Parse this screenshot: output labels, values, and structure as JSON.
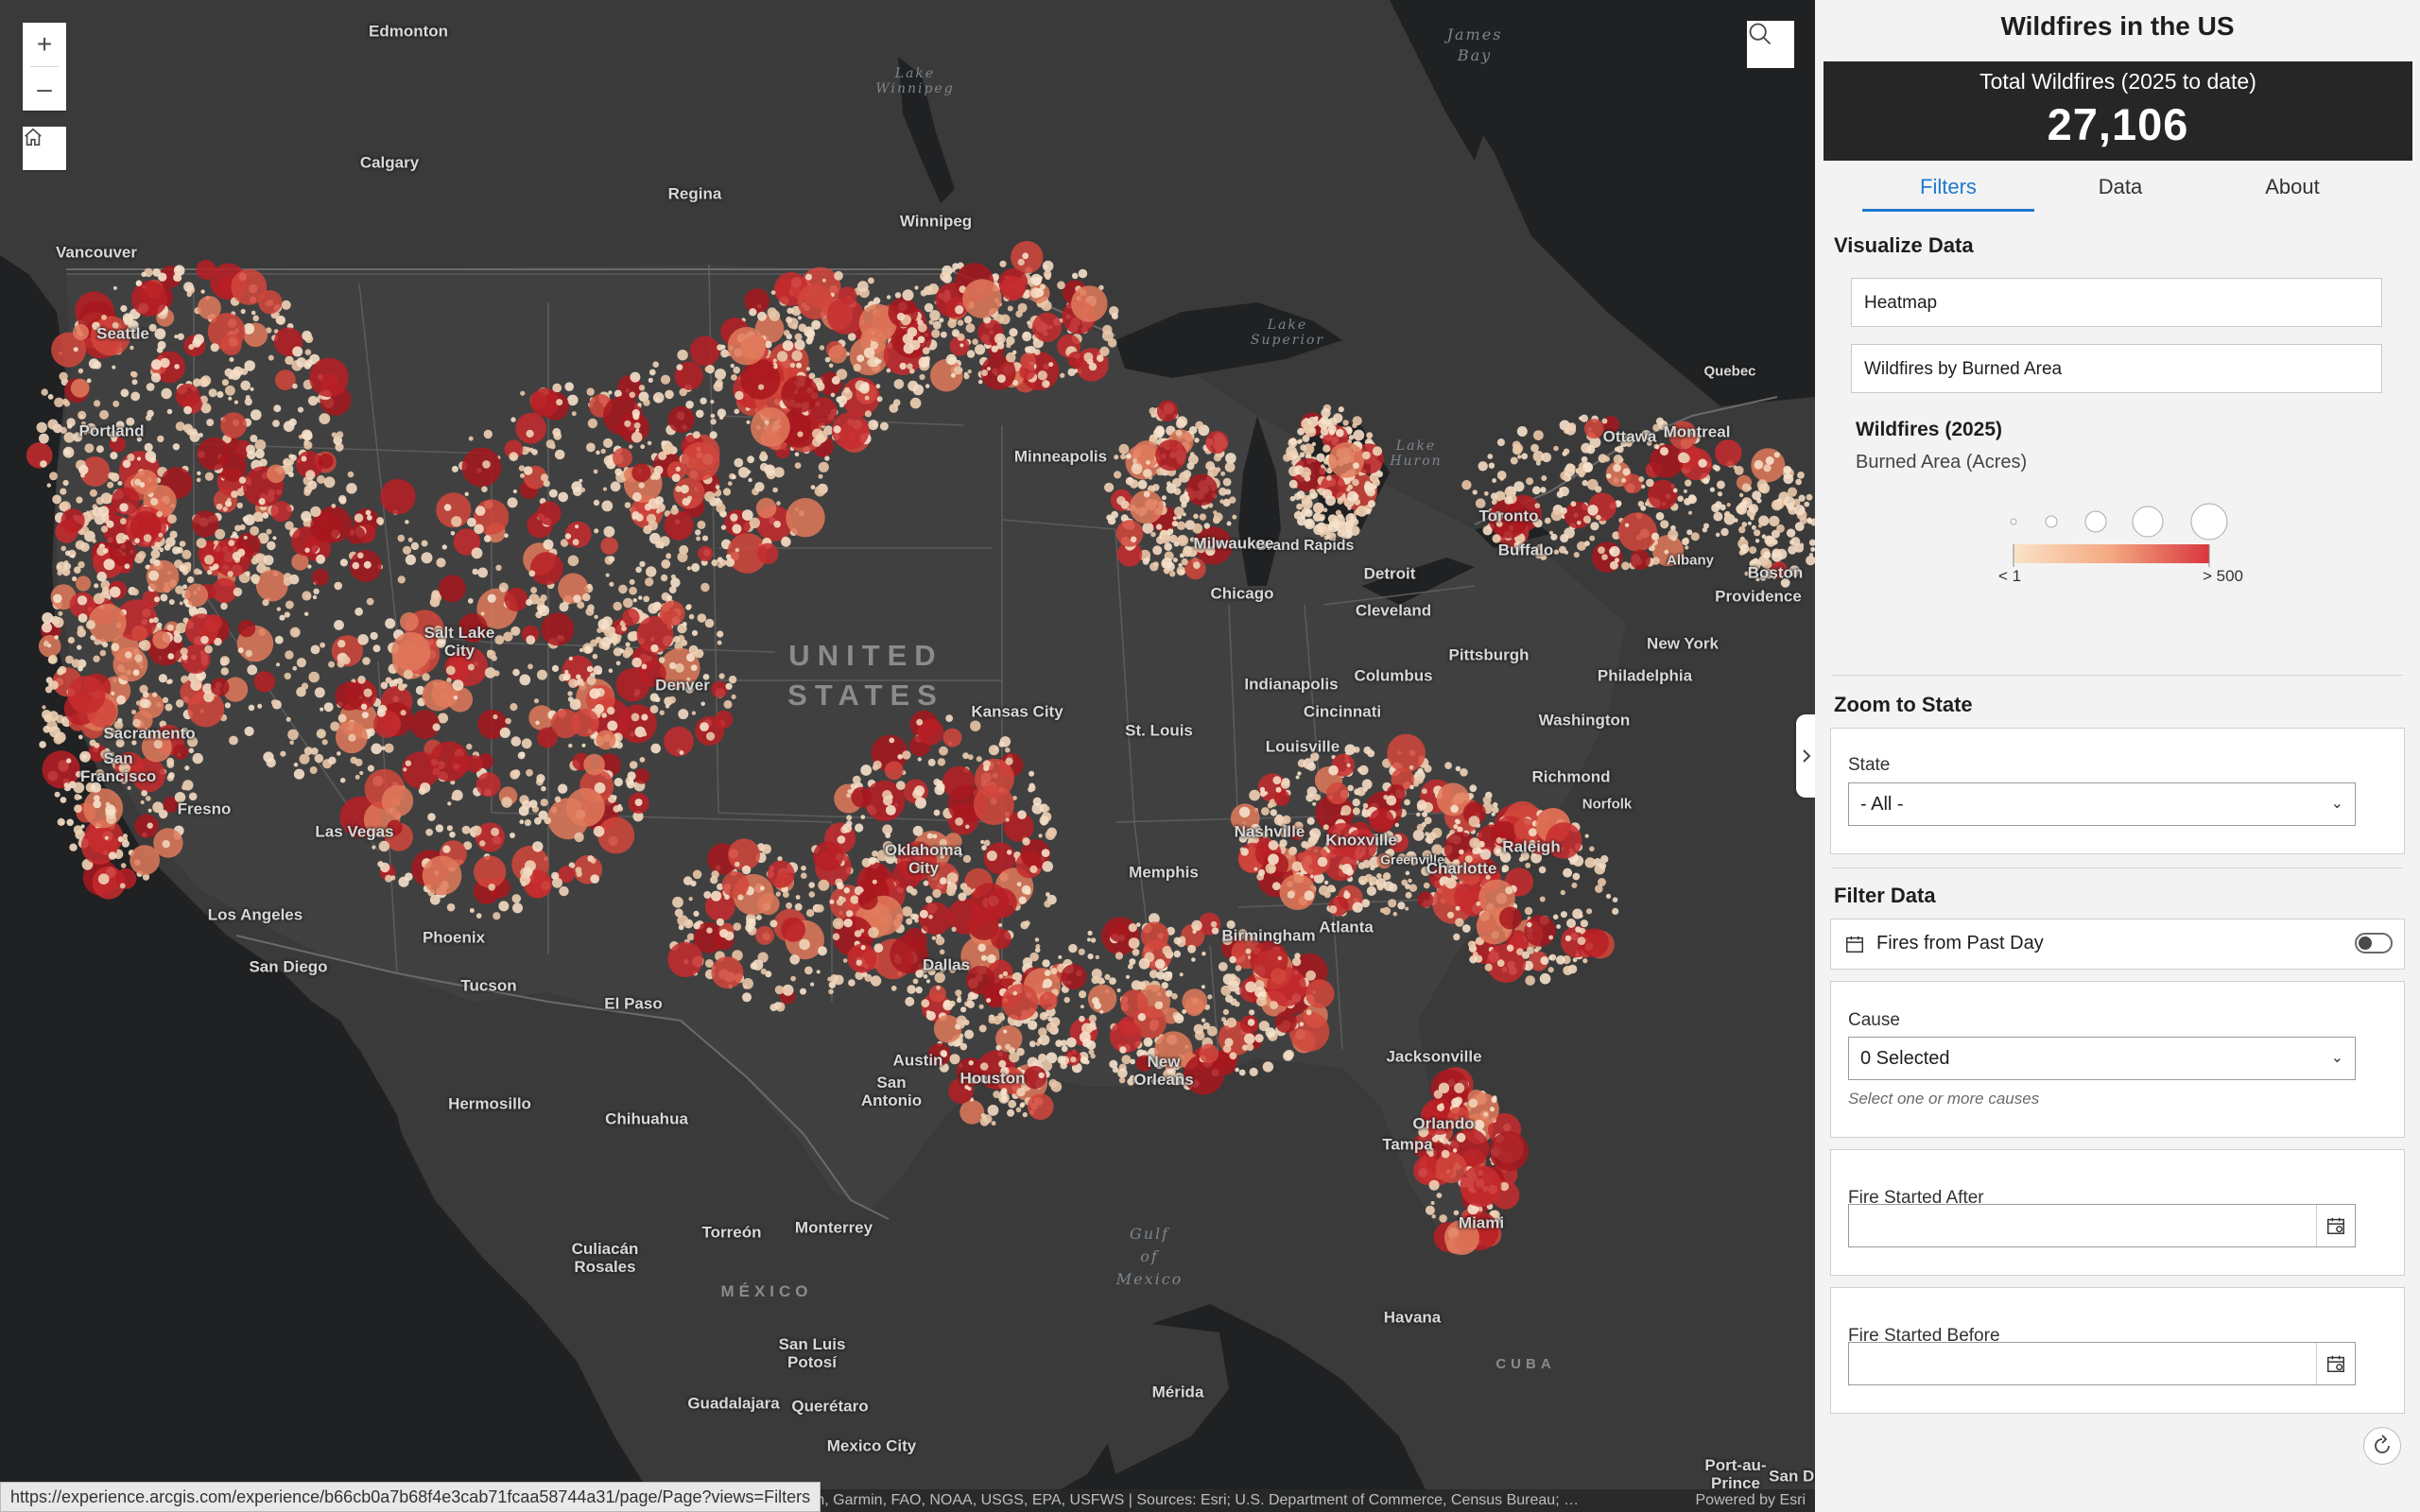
{
  "app": {
    "title": "Wildfires in the US"
  },
  "summary": {
    "label": "Total Wildfires (2025 to date)",
    "value": "27,106"
  },
  "tabs": [
    {
      "label": "Filters",
      "active": true
    },
    {
      "label": "Data",
      "active": false
    },
    {
      "label": "About",
      "active": false
    }
  ],
  "visualize": {
    "title": "Visualize Data",
    "options": [
      "Heatmap",
      "Wildfires by Burned Area"
    ]
  },
  "legend": {
    "title": "Wildfires (2025)",
    "subtitle": "Burned Area (Acres)",
    "min_label": "< 1",
    "max_label": "> 500",
    "ramp_colors": [
      "#fbe3c8",
      "#f3a880",
      "#d9363e"
    ]
  },
  "zoom_state": {
    "title": "Zoom to State",
    "field_label": "State",
    "value": "- All -"
  },
  "filter": {
    "title": "Filter Data",
    "past_day_label": "Fires from Past Day",
    "past_day_on": false,
    "cause_label": "Cause",
    "cause_value": "0 Selected",
    "cause_hint": "Select one or more causes",
    "after_label": "Fire Started After",
    "before_label": "Fire Started Before"
  },
  "map": {
    "zoom_in": "+",
    "zoom_out": "–",
    "attribution": "om, Garmin, FAO, NOAA, USGS, EPA, USFWS | Sources: Esri; U.S. Department of Commerce, Census Bureau; …",
    "powered": "Powered by Esri",
    "url_tooltip": "https://experience.arcgis.com/experience/b66cb0a7b68f4e3cab71fcaa58744a31/page/Page?views=Filters",
    "icons": {
      "home": "home-icon",
      "search": "search-icon",
      "collapse": "chevron-right-icon",
      "reset": "refresh-icon",
      "calendar": "calendar-icon"
    },
    "cities": [
      "Edmonton",
      "Calgary",
      "Regina",
      "Winnipeg",
      "Vancouver",
      "Seattle",
      "Portland",
      "Quebec",
      "Ottawa",
      "Montreal",
      "Toronto",
      "Buffalo",
      "Albany",
      "Boston",
      "Providence",
      "New York",
      "Philadelphia",
      "Washington",
      "Richmond",
      "Norfolk",
      "Pittsburgh",
      "Cleveland",
      "Detroit",
      "Grand Rapids",
      "Milwaukee",
      "Chicago",
      "Minneapolis",
      "Indianapolis",
      "Columbus",
      "Cincinnati",
      "Louisville",
      "St. Louis",
      "Kansas City",
      "Denver",
      "Salt Lake City",
      "Sacramento",
      "San Francisco",
      "Fresno",
      "Las Vegas",
      "Los Angeles",
      "San Diego",
      "Phoenix",
      "Tucson",
      "El Paso",
      "Oklahoma City",
      "Dallas",
      "Austin",
      "San Antonio",
      "Houston",
      "New Orleans",
      "Memphis",
      "Nashville",
      "Knoxville",
      "Greenville",
      "Charlotte",
      "Raleigh",
      "Atlanta",
      "Birmingham",
      "Jacksonville",
      "Orlando",
      "Tampa",
      "Miami",
      "Hermosillo",
      "Chihuahua",
      "Torreón",
      "Monterrey",
      "Culiacán Rosales",
      "San Luis Potosí",
      "Guadalajara",
      "Querétaro",
      "Mexico City",
      "Mérida",
      "Havana",
      "Port-au-Prince",
      "San Dom"
    ],
    "water": [
      "James Bay",
      "Lake Winnipeg",
      "Lake Superior",
      "Lake Huron",
      "Gulf of Mexico"
    ],
    "countries": [
      "UNITED STATES",
      "MÉXICO",
      "CUBA"
    ]
  }
}
